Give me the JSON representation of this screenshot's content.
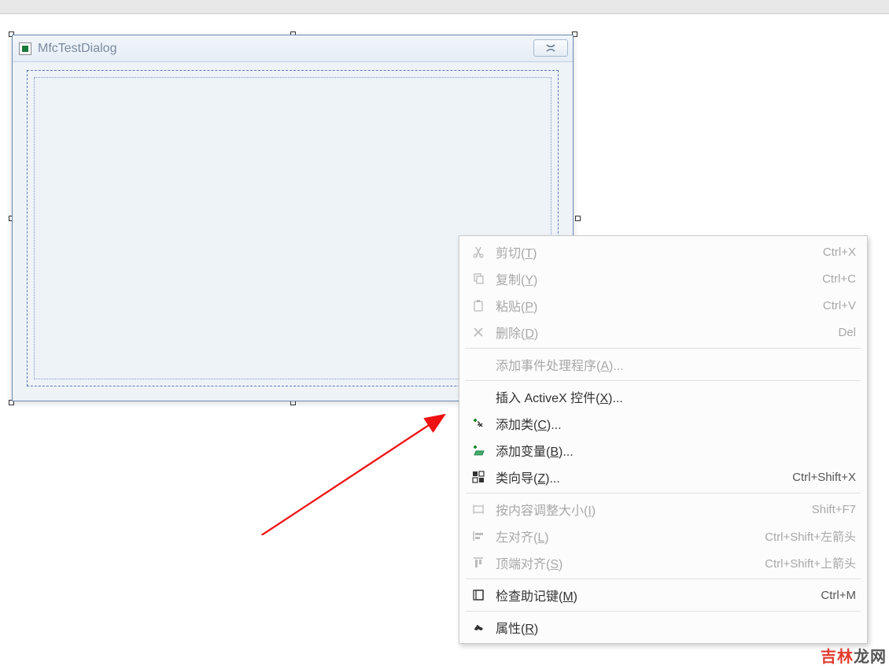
{
  "dialog": {
    "title": "MfcTestDialog"
  },
  "menu": {
    "items": [
      {
        "icon": "cut-icon",
        "label_before": "剪切(",
        "key": "T",
        "label_after": ")",
        "shortcut": "Ctrl+X",
        "disabled": true
      },
      {
        "icon": "copy-icon",
        "label_before": "复制(",
        "key": "Y",
        "label_after": ")",
        "shortcut": "Ctrl+C",
        "disabled": true
      },
      {
        "icon": "paste-icon",
        "label_before": "粘贴(",
        "key": "P",
        "label_after": ")",
        "shortcut": "Ctrl+V",
        "disabled": true
      },
      {
        "icon": "delete-icon",
        "label_before": "删除(",
        "key": "D",
        "label_after": ")",
        "shortcut": "Del",
        "disabled": true
      },
      {
        "sep": true
      },
      {
        "icon": "",
        "label_before": "添加事件处理程序(",
        "key": "A",
        "label_after": ")...",
        "shortcut": "",
        "disabled": true
      },
      {
        "sep": true
      },
      {
        "icon": "",
        "label_before": "插入 ActiveX 控件(",
        "key": "X",
        "label_after": ")...",
        "shortcut": "",
        "disabled": false
      },
      {
        "icon": "add-class-icon",
        "label_before": "添加类(",
        "key": "C",
        "label_after": ")...",
        "shortcut": "",
        "disabled": false
      },
      {
        "icon": "add-variable-icon",
        "label_before": "添加变量(",
        "key": "B",
        "label_after": ")...",
        "shortcut": "",
        "disabled": false
      },
      {
        "icon": "class-wizard-icon",
        "label_before": "类向导(",
        "key": "Z",
        "label_after": ")...",
        "shortcut": "Ctrl+Shift+X",
        "disabled": false
      },
      {
        "sep": true
      },
      {
        "icon": "resize-icon",
        "label_before": "按内容调整大小(",
        "key": "I",
        "label_after": ")",
        "shortcut": "Shift+F7",
        "disabled": true
      },
      {
        "icon": "align-left-icon",
        "label_before": "左对齐(",
        "key": "L",
        "label_after": ")",
        "shortcut": "Ctrl+Shift+左箭头",
        "disabled": true
      },
      {
        "icon": "align-top-icon",
        "label_before": "顶端对齐(",
        "key": "S",
        "label_after": ")",
        "shortcut": "Ctrl+Shift+上箭头",
        "disabled": true
      },
      {
        "sep": true
      },
      {
        "icon": "mnemonics-icon",
        "label_before": "检查助记键(",
        "key": "M",
        "label_after": ")",
        "shortcut": "Ctrl+M",
        "disabled": false
      },
      {
        "sep": true
      },
      {
        "icon": "properties-icon",
        "label_before": "属性(",
        "key": "R",
        "label_after": ")",
        "shortcut": "",
        "disabled": false
      }
    ]
  },
  "watermark": {
    "part1": "吉林",
    "part2": "龙网"
  }
}
